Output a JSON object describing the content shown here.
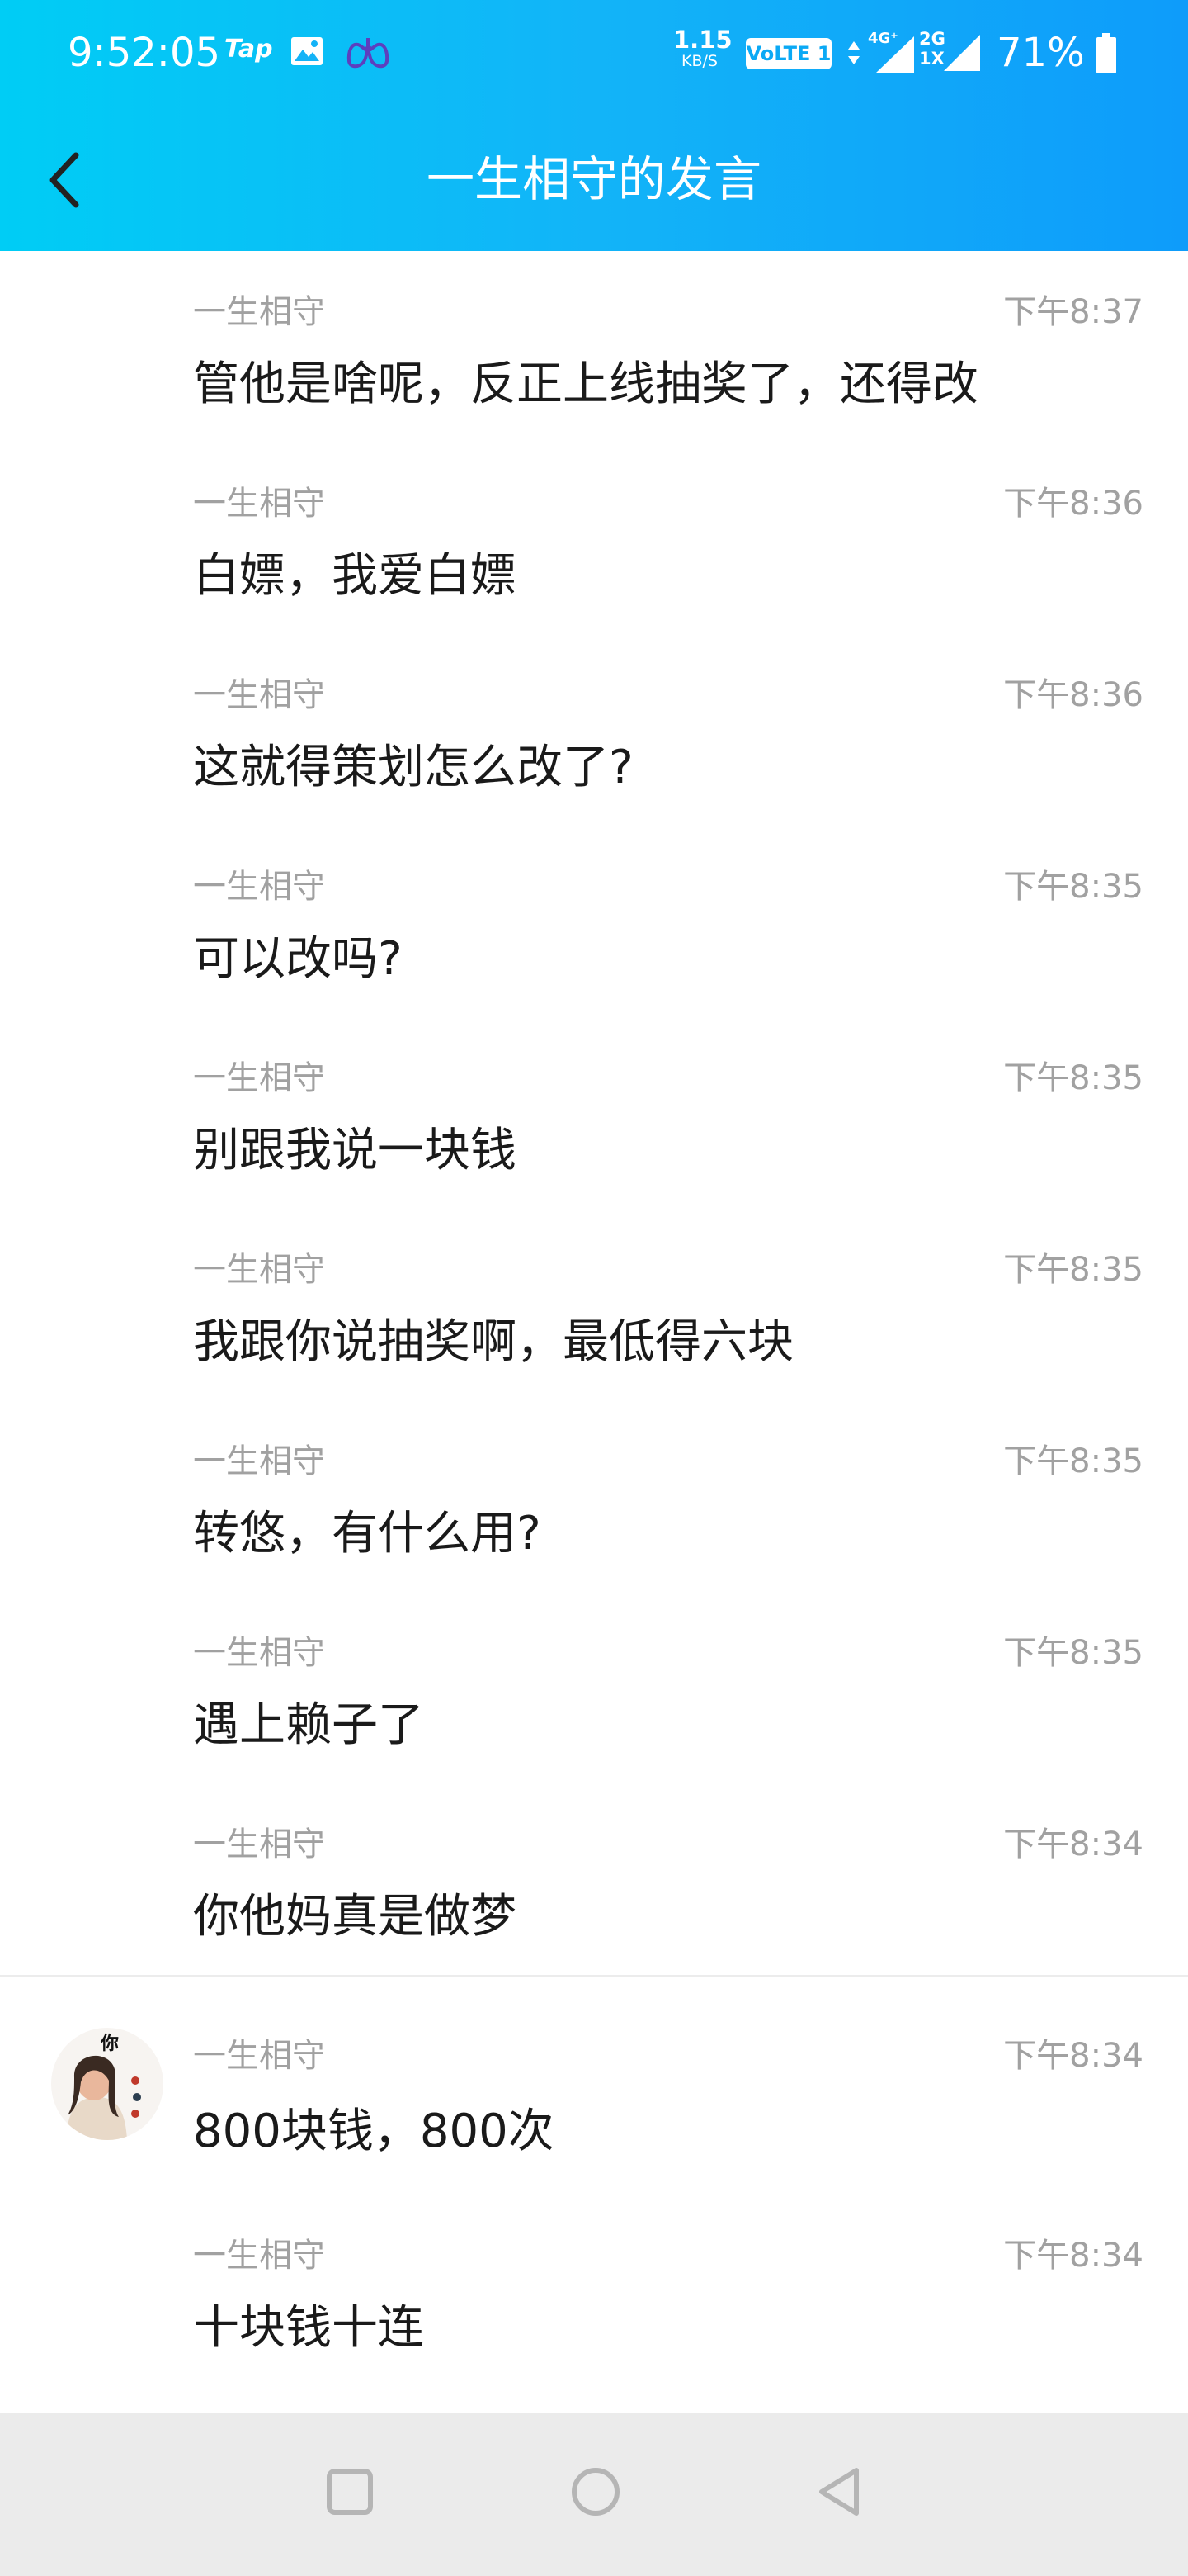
{
  "status_bar": {
    "time": "9:52:05",
    "tap_label": "Tap",
    "net_speed_value": "1.15",
    "net_speed_unit": "KB/S",
    "volte": "VoLTE 1",
    "sig1_label": "4G⁺",
    "sig2_label_top": "2G",
    "sig2_label_bottom": "1X",
    "battery": "71%"
  },
  "title_bar": {
    "title": "一生相守的发言"
  },
  "messages_top": [
    {
      "sender": "一生相守",
      "time": "下午8:37",
      "text": "管他是啥呢，反正上线抽奖了，还得改"
    },
    {
      "sender": "一生相守",
      "time": "下午8:36",
      "text": "白嫖，我爱白嫖"
    },
    {
      "sender": "一生相守",
      "time": "下午8:36",
      "text": "这就得策划怎么改了?"
    },
    {
      "sender": "一生相守",
      "time": "下午8:35",
      "text": "可以改吗?"
    },
    {
      "sender": "一生相守",
      "time": "下午8:35",
      "text": "别跟我说一块钱"
    },
    {
      "sender": "一生相守",
      "time": "下午8:35",
      "text": "我跟你说抽奖啊，最低得六块"
    },
    {
      "sender": "一生相守",
      "time": "下午8:35",
      "text": "转悠，有什么用?"
    },
    {
      "sender": "一生相守",
      "time": "下午8:35",
      "text": "遇上赖子了"
    },
    {
      "sender": "一生相守",
      "time": "下午8:34",
      "text": "你他妈真是做梦"
    }
  ],
  "messages_bottom": [
    {
      "sender": "一生相守",
      "time": "下午8:34",
      "text": "800块钱，800次"
    },
    {
      "sender": "一生相守",
      "time": "下午8:34",
      "text": "十块钱十连"
    }
  ],
  "avatar_text": "你",
  "colors": {
    "header_start": "#00cdf5",
    "header_end": "#0e9cfa",
    "meta_text": "#a1a1a1",
    "body_text": "#1a1a1a",
    "nav_bar": "#ebebeb"
  }
}
